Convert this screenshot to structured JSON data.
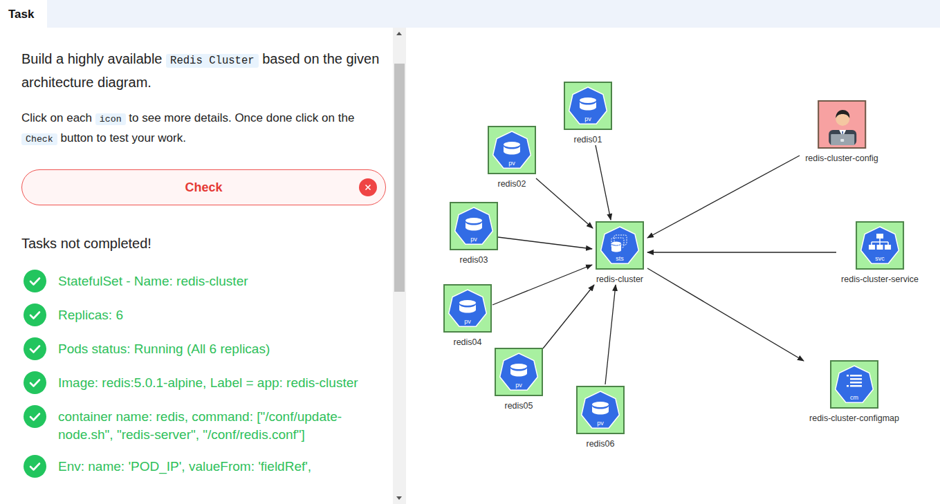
{
  "tabs": [
    {
      "label": "Task",
      "selected": true
    }
  ],
  "intro": [
    {
      "text": "Build a highly available ",
      "code": false
    },
    {
      "text": "Redis Cluster",
      "code": true
    },
    {
      "text": " based on the given architecture diagram.",
      "code": false
    }
  ],
  "instructions": [
    {
      "text": "Click on each ",
      "code": false
    },
    {
      "text": "icon",
      "code": true
    },
    {
      "text": " to see more details. Once done click on the ",
      "code": false
    },
    {
      "text": "Check",
      "code": true
    },
    {
      "text": " button to test your work.",
      "code": false
    }
  ],
  "check_button": {
    "label": "Check",
    "passed": false
  },
  "result": "Tasks not completed!",
  "tasks": [
    {
      "text": "StatefulSet - Name: redis-cluster",
      "completed": true
    },
    {
      "text": "Replicas: 6",
      "completed": true
    },
    {
      "text": "Pods status: Running (All 6 replicas)",
      "completed": true
    },
    {
      "text": "Image: redis:5.0.1-alpine, Label = app: redis-cluster",
      "completed": true
    },
    {
      "text": "container name: redis, command: [\"/conf/update-node.sh\", \"redis-server\", \"/conf/redis.conf\"]",
      "completed": true
    },
    {
      "text": "Env: name: 'POD_IP', valueFrom: 'fieldRef',",
      "completed": true
    }
  ],
  "diagram": {
    "nodes": [
      {
        "label": "redis01",
        "kind": "pv",
        "badge": "pv",
        "color": "#a8f0a0"
      },
      {
        "label": "redis02",
        "kind": "pv",
        "badge": "pv",
        "color": "#a8f0a0"
      },
      {
        "label": "redis03",
        "kind": "pv",
        "badge": "pv",
        "color": "#a8f0a0"
      },
      {
        "label": "redis04",
        "kind": "pv",
        "badge": "pv",
        "color": "#a8f0a0"
      },
      {
        "label": "redis05",
        "kind": "pv",
        "badge": "pv",
        "color": "#a8f0a0"
      },
      {
        "label": "redis06",
        "kind": "pv",
        "badge": "pv",
        "color": "#a8f0a0"
      },
      {
        "label": "redis-cluster",
        "kind": "sts",
        "badge": "sts",
        "color": "#a8f0a0"
      },
      {
        "label": "redis-cluster-config",
        "kind": "user",
        "badge": "",
        "color": "#f7a1a1"
      },
      {
        "label": "redis-cluster-service",
        "kind": "svc",
        "badge": "svc",
        "color": "#a8f0a0"
      },
      {
        "label": "redis-cluster-configmap",
        "kind": "cm",
        "badge": "cm",
        "color": "#a8f0a0"
      }
    ],
    "edges": [
      {
        "from": "redis01",
        "to": "redis-cluster"
      },
      {
        "from": "redis02",
        "to": "redis-cluster"
      },
      {
        "from": "redis03",
        "to": "redis-cluster"
      },
      {
        "from": "redis04",
        "to": "redis-cluster"
      },
      {
        "from": "redis05",
        "to": "redis-cluster"
      },
      {
        "from": "redis06",
        "to": "redis-cluster"
      },
      {
        "from": "redis-cluster-config",
        "to": "redis-cluster"
      },
      {
        "from": "redis-cluster-service",
        "to": "redis-cluster"
      },
      {
        "from": "redis-cluster",
        "to": "redis-cluster-configmap"
      }
    ]
  }
}
